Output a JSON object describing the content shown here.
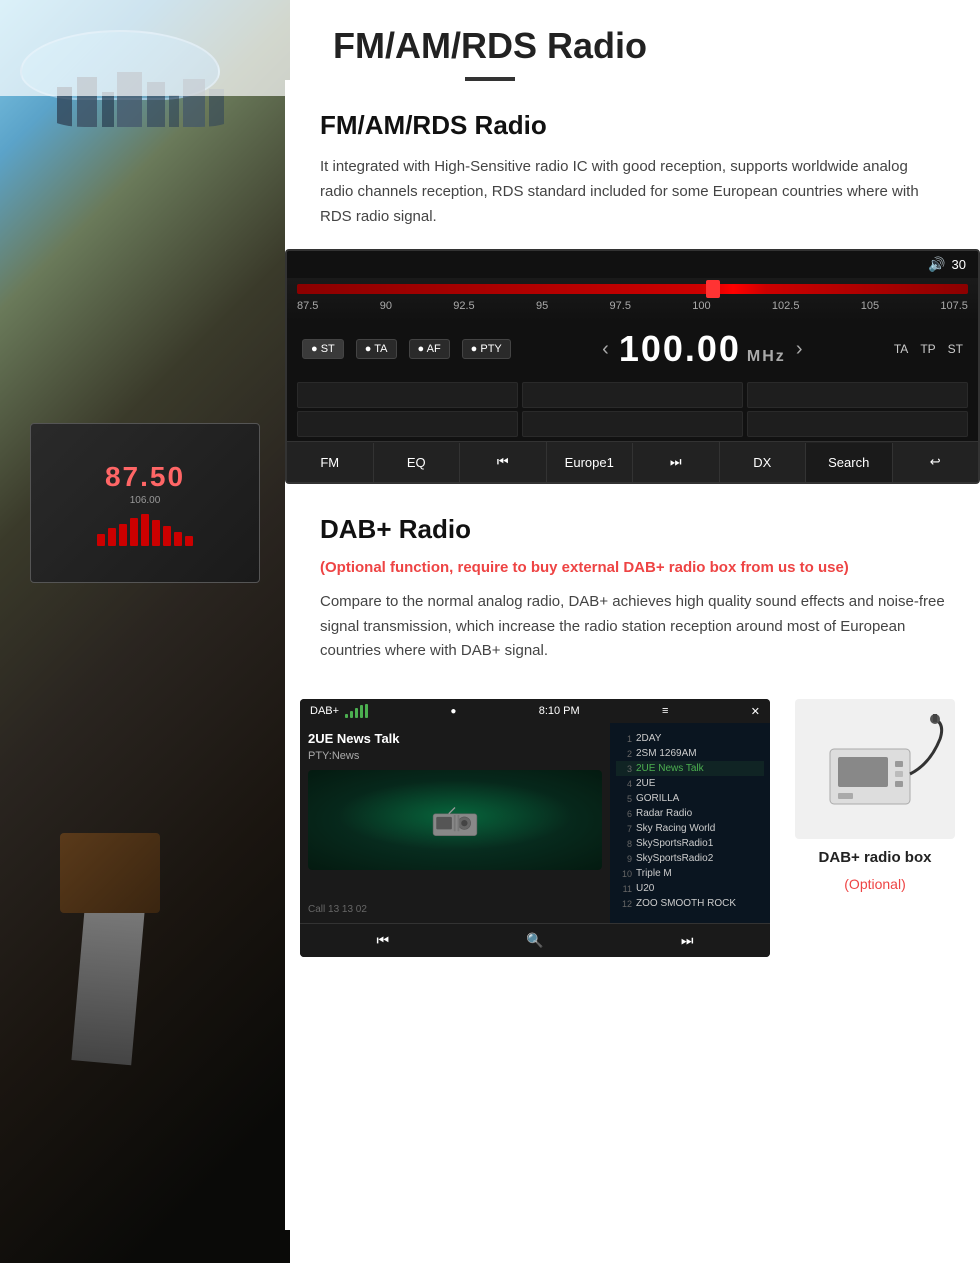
{
  "page": {
    "title": "FM/AM/RDS Radio",
    "title_underline": true
  },
  "header": {
    "title": "FM/AM/RDS Radio"
  },
  "fm_section": {
    "title": "FM/AM/RDS Radio",
    "description": "It integrated with High-Sensitive radio IC with good reception, supports worldwide analog radio channels reception, RDS standard included for some European countries where with RDS radio signal."
  },
  "radio_ui": {
    "volume_label": "30",
    "freq_value": "100.00",
    "freq_unit": "MHz",
    "freq_min": "87.5",
    "freq_marks": [
      "87.5",
      "90",
      "92.5",
      "95",
      "97.5",
      "100",
      "102.5",
      "105",
      "107.5"
    ],
    "buttons_left": [
      "ST",
      "TA",
      "AF",
      "PTY"
    ],
    "buttons_right": [
      "TA",
      "TP",
      "ST"
    ],
    "toolbar": {
      "items": [
        "FM",
        "EQ",
        "⏮",
        "Europe1",
        "⏭",
        "DX",
        "Search",
        "↩"
      ]
    }
  },
  "dab_section": {
    "title": "DAB+ Radio",
    "optional_text": "(Optional function, require to buy external DAB+ radio box from us to use)",
    "description": "Compare to the normal analog radio, DAB+ achieves high quality sound effects and noise-free signal transmission, which increase the radio station reception around most of European countries where with DAB+ signal."
  },
  "dab_ui": {
    "header_label": "DAB+",
    "time": "8:10 PM",
    "station": "2UE News Talk",
    "pty": "PTY:News",
    "call_label": "Call 13 13 02",
    "channels": [
      {
        "num": "1",
        "name": "2DAY",
        "active": false
      },
      {
        "num": "2",
        "name": "2SM 1269AM",
        "active": false
      },
      {
        "num": "3",
        "name": "2UE News Talk",
        "active": true
      },
      {
        "num": "4",
        "name": "2UE",
        "active": false
      },
      {
        "num": "5",
        "name": "GORILLA",
        "active": false
      },
      {
        "num": "6",
        "name": "Radar Radio",
        "active": false
      },
      {
        "num": "7",
        "name": "Sky Racing World",
        "active": false
      },
      {
        "num": "8",
        "name": "SkySportsRadio1",
        "active": false
      },
      {
        "num": "9",
        "name": "SkySportsRadio2",
        "active": false
      },
      {
        "num": "10",
        "name": "Triple M",
        "active": false
      },
      {
        "num": "11",
        "name": "U20",
        "active": false
      },
      {
        "num": "12",
        "name": "ZOO SMOOTH ROCK",
        "active": false
      }
    ]
  },
  "dab_box": {
    "name": "DAB+ radio box",
    "optional": "(Optional)"
  },
  "colors": {
    "accent_red": "#e44444",
    "accent_green": "#4CAF50",
    "title_dark": "#111111",
    "text_gray": "#444444",
    "optional_color": "#e44444"
  }
}
